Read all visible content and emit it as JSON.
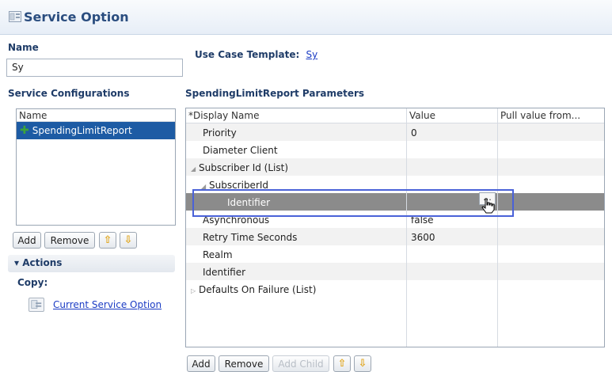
{
  "header": {
    "title": "Service Option",
    "icon": "service-option-icon"
  },
  "name_section": {
    "label": "Name",
    "value": "Sy"
  },
  "use_case": {
    "label": "Use Case Template:",
    "link": "Sy"
  },
  "service_configurations": {
    "label": "Service Configurations",
    "column_header": "Name",
    "items": [
      {
        "label": "SpendingLimitReport",
        "selected": true
      }
    ]
  },
  "left_buttons": {
    "add": "Add",
    "remove": "Remove"
  },
  "actions": {
    "title": "Actions",
    "copy_label": "Copy:",
    "copy_link": "Current Service Option"
  },
  "params": {
    "title": "SpendingLimitReport Parameters",
    "columns": [
      "*Display Name",
      "Value",
      "Pull value from..."
    ],
    "rows": [
      {
        "name": "Priority",
        "value": "0"
      },
      {
        "name": "Diameter Client",
        "value": ""
      },
      {
        "name": "Subscriber Id (List)",
        "value": ""
      },
      {
        "name": "SubscriberId",
        "value": ""
      },
      {
        "name": "Identifier",
        "value": ""
      },
      {
        "name": "Asynchronous",
        "value": "false"
      },
      {
        "name": "Retry Time Seconds",
        "value": "3600"
      },
      {
        "name": "Realm",
        "value": ""
      },
      {
        "name": "Identifier",
        "value": ""
      },
      {
        "name": "Defaults On Failure (List)",
        "value": ""
      }
    ],
    "ellipsis_button": "..."
  },
  "bottom_buttons": {
    "add": "Add",
    "remove": "Remove",
    "add_child": "Add Child"
  },
  "colors": {
    "accent": "#1d5ba4",
    "header_text": "#2a4d7f",
    "link": "#1b3cc4",
    "selection": "#8b8b8b"
  }
}
